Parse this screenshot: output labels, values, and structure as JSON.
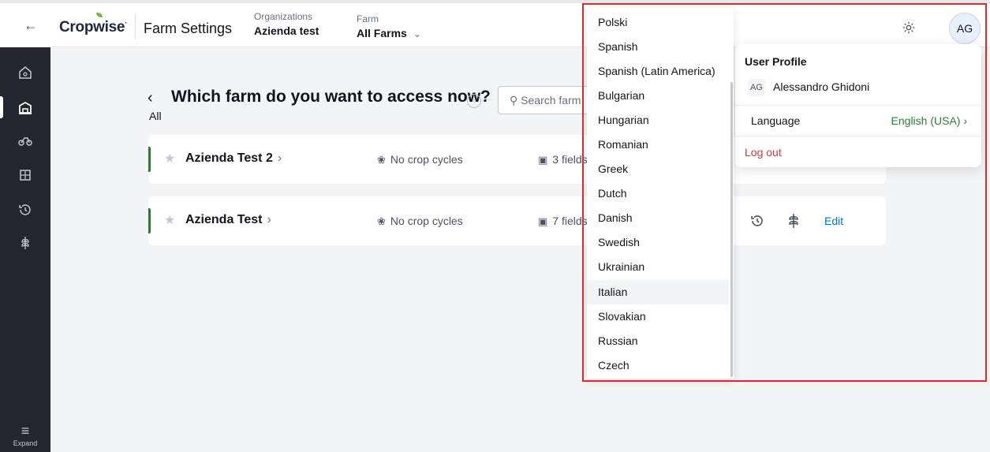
{
  "topbar": {
    "brand": "Cropwise",
    "app_title": "Farm Settings",
    "org_label": "Organizations",
    "org_value": "Azienda test",
    "farm_label": "Farm",
    "farm_value": "All Farms",
    "user_initials": "AG"
  },
  "sidebar": {
    "expand_label": "Expand"
  },
  "page": {
    "title": "Which farm do you want to access now?",
    "search_placeholder": "Search farm",
    "filter_label": "All"
  },
  "farms": [
    {
      "name": "Azienda Test 2",
      "crop": "No crop cycles",
      "fields": "3 fields"
    },
    {
      "name": "Azienda Test",
      "crop": "No crop cycles",
      "fields": "7 fields",
      "edit": "Edit"
    }
  ],
  "profile": {
    "header": "User Profile",
    "initials": "AG",
    "name": "Alessandro Ghidoni",
    "language_label": "Language",
    "language_value": "English (USA) ›",
    "logout": "Log out"
  },
  "languages": [
    "Polski",
    "Spanish",
    "Spanish (Latin America)",
    "Bulgarian",
    "Hungarian",
    "Romanian",
    "Greek",
    "Dutch",
    "Danish",
    "Swedish",
    "Ukrainian",
    "Italian",
    "Slovakian",
    "Russian",
    "Czech"
  ],
  "hovered_language": "Italian",
  "colors": {
    "accent": "#2b7d2f",
    "link": "#0071cd",
    "danger": "#d0393e",
    "sidebar": "#232630",
    "highlight": "#e3282b"
  }
}
